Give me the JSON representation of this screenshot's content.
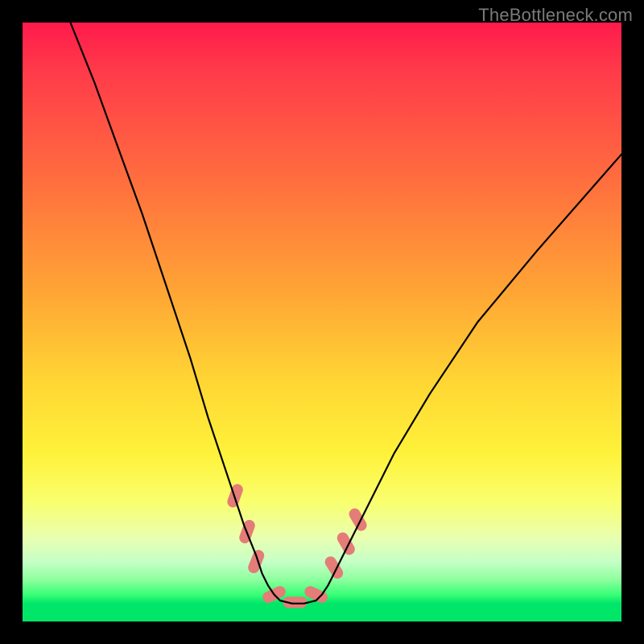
{
  "watermark": "TheBottleneck.com",
  "colors": {
    "background": "#000000",
    "gradient_top": "#ff1a4b",
    "gradient_mid": "#fff23a",
    "gradient_bottom": "#00e668",
    "curve": "#000000",
    "marker": "#e47c78"
  },
  "chart_data": {
    "type": "line",
    "title": "",
    "xlabel": "",
    "ylabel": "",
    "xlim": [
      0,
      100
    ],
    "ylim": [
      0,
      100
    ],
    "note": "Axes are unlabeled; values are relative percentages of the plot area. The single curve is roughly V-shaped with a flat minimum near y≈3 around x≈42–49. Salmon lozenge markers highlight points on the curve near the minimum.",
    "series": [
      {
        "name": "curve",
        "x": [
          8,
          12,
          16,
          20,
          24,
          28,
          31,
          33,
          35,
          37,
          39,
          40,
          41,
          42,
          43,
          45,
          47,
          49,
          50,
          51,
          52,
          53,
          55,
          58,
          62,
          68,
          76,
          86,
          100
        ],
        "y": [
          100,
          90,
          79,
          68,
          56,
          44,
          34,
          28,
          22,
          16,
          11,
          8,
          6,
          4.5,
          3.5,
          3,
          3,
          3.5,
          4.5,
          6,
          8,
          10,
          14,
          20,
          28,
          38,
          50,
          62,
          78
        ]
      }
    ],
    "markers": [
      {
        "x": 35.5,
        "y": 21,
        "angle": -70
      },
      {
        "x": 37.5,
        "y": 15,
        "angle": -70
      },
      {
        "x": 39,
        "y": 10,
        "angle": -68
      },
      {
        "x": 42,
        "y": 4.5,
        "angle": -25
      },
      {
        "x": 45.5,
        "y": 3.2,
        "angle": 0
      },
      {
        "x": 49,
        "y": 4.5,
        "angle": 25
      },
      {
        "x": 52,
        "y": 9,
        "angle": 58
      },
      {
        "x": 54,
        "y": 13,
        "angle": 60
      },
      {
        "x": 56,
        "y": 17,
        "angle": 60
      }
    ]
  }
}
